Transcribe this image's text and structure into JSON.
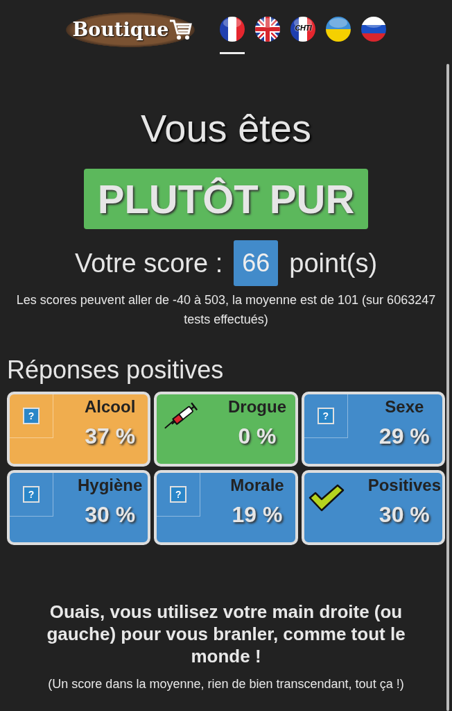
{
  "header": {
    "logo": "Boutique",
    "languages": [
      {
        "kind": "fr",
        "selected": true
      },
      {
        "kind": "gb",
        "selected": false
      },
      {
        "kind": "chti",
        "label": "CHTI",
        "selected": false
      },
      {
        "kind": "ua",
        "selected": false
      },
      {
        "kind": "ru",
        "selected": false
      }
    ]
  },
  "result": {
    "heading": "Vous êtes",
    "verdict": "PLUTÔT PUR",
    "score_label": "Votre score :",
    "score": "66",
    "score_unit": "point(s)",
    "note": "Les scores peuvent aller de -40 à 503, la moyenne est de 101 (sur 6063247 tests effectués)"
  },
  "positives": {
    "title": "Réponses positives",
    "tiles": [
      {
        "name": "Alcool",
        "value": "37 %",
        "color": "#f0ad4e",
        "kind": "missing",
        "glyph": "?"
      },
      {
        "name": "Drogue",
        "value": "0 %",
        "color": "#5cb85c",
        "kind": "syringe"
      },
      {
        "name": "Sexe",
        "value": "29 %",
        "color": "#428bca",
        "kind": "missing",
        "glyph": "?"
      },
      {
        "name": "Hygiène",
        "value": "30 %",
        "color": "#428bca",
        "kind": "missing",
        "glyph": "?"
      },
      {
        "name": "Morale",
        "value": "19 %",
        "color": "#428bca",
        "kind": "missing",
        "glyph": "?"
      },
      {
        "name": "Positives",
        "value": "30 %",
        "color": "#428bca",
        "kind": "check"
      }
    ]
  },
  "comment": {
    "text": "Ouais, vous utilisez votre main droite (ou gauche) pour vous branler, comme tout le monde !",
    "subtext": "(Un score dans la moyenne, rien de bien transcendant, tout ça !)"
  }
}
